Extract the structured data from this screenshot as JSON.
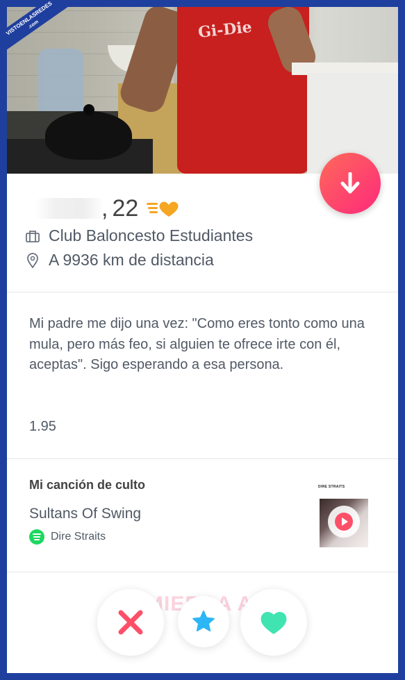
{
  "watermark": {
    "line1": "VISTOENLASREDES",
    "line2": ".com"
  },
  "photo": {
    "apron_text": "Gi-Die"
  },
  "profile": {
    "age": "22",
    "school": "Club Baloncesto Estudiantes",
    "distance": "A 9936 km de distancia",
    "bio": "Mi padre me dijo una vez: \"Como eres tonto como una mula, pero más feo, si alguien te ofrece irte con él, aceptas\". Sigo esperando a esa persona.",
    "height": "1.95"
  },
  "anthem": {
    "section_title": "Mi canción de culto",
    "song": "Sultans Of Swing",
    "artist": "Dire Straits",
    "album_label": "DIRE STRAITS"
  },
  "footer_faded_text": "MIERDA A",
  "icons": {
    "work": "briefcase-icon",
    "location": "location-pin-icon",
    "spotify": "spotify-icon",
    "scroll": "arrow-down-icon",
    "nope": "x-icon",
    "superlike": "star-icon",
    "like": "heart-icon"
  },
  "colors": {
    "brand_gradient_start": "#ff6a5a",
    "brand_gradient_end": "#fd297b",
    "nope": "#fd5068",
    "superlike": "#2db6f5",
    "like": "#3fe4b1",
    "frame": "#1f3f9e"
  }
}
